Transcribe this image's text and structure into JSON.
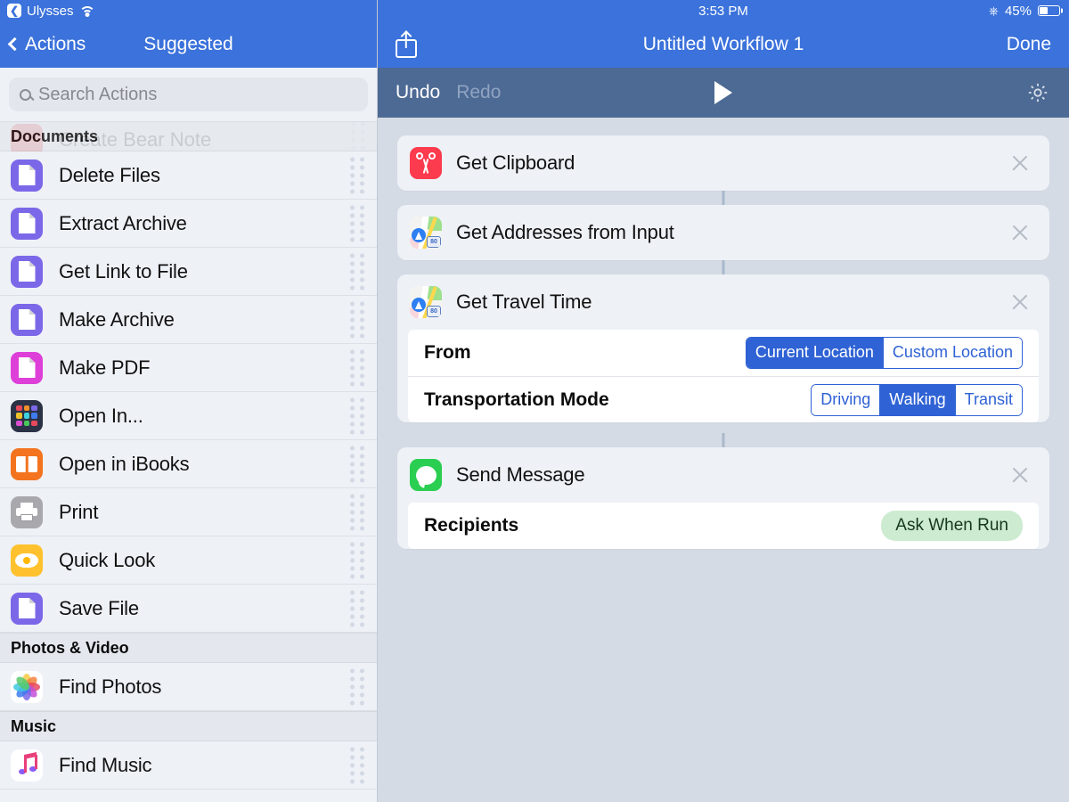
{
  "sidebar": {
    "status": {
      "app_back_label": "Ulysses",
      "wifi_icon": "wifi-icon"
    },
    "navbar": {
      "back_label": "Actions",
      "title": "Suggested"
    },
    "search": {
      "placeholder": "Search Actions",
      "icon": "search-icon"
    },
    "ghost_row": {
      "label": "Create Bear Note"
    },
    "sections": [
      {
        "title": "Documents",
        "items": [
          {
            "label": "Delete Files",
            "icon": "document-icon",
            "bg": "#7B68E8",
            "art": "doc"
          },
          {
            "label": "Extract Archive",
            "icon": "document-icon",
            "bg": "#7B68E8",
            "art": "doc"
          },
          {
            "label": "Get Link to File",
            "icon": "document-icon",
            "bg": "#7B68E8",
            "art": "doc"
          },
          {
            "label": "Make Archive",
            "icon": "document-icon",
            "bg": "#7B68E8",
            "art": "doc"
          },
          {
            "label": "Make PDF",
            "icon": "make-pdf-icon",
            "bg": "#DE3FD8",
            "art": "pdf"
          },
          {
            "label": "Open In...",
            "icon": "open-in-icon",
            "bg": "#2C3246",
            "art": "grid"
          },
          {
            "label": "Open in iBooks",
            "icon": "ibooks-icon",
            "bg": "#F4731E",
            "art": "book"
          },
          {
            "label": "Print",
            "icon": "printer-icon",
            "bg": "#A8A8AD",
            "art": "printer"
          },
          {
            "label": "Quick Look",
            "icon": "quick-look-icon",
            "bg": "#FFC22E",
            "art": "eye"
          },
          {
            "label": "Save File",
            "icon": "document-icon",
            "bg": "#7B68E8",
            "art": "doc"
          }
        ]
      },
      {
        "title": "Photos & Video",
        "items": [
          {
            "label": "Find Photos",
            "icon": "photos-app-icon",
            "bg": "#FFFFFF",
            "art": "photos"
          }
        ]
      },
      {
        "title": "Music",
        "items": [
          {
            "label": "Find Music",
            "icon": "music-app-icon",
            "bg": "#FFFFFF",
            "art": "music"
          }
        ]
      }
    ],
    "grip_icon": "drag-handle-icon"
  },
  "right": {
    "status": {
      "time": "3:53 PM",
      "bluetooth_icon": "bluetooth-icon",
      "battery_percent": "45%",
      "battery_level": 45
    },
    "navbar": {
      "share_icon": "share-icon",
      "title": "Untitled Workflow 1",
      "done_label": "Done"
    },
    "toolbar": {
      "undo_label": "Undo",
      "redo_label": "Redo",
      "play_icon": "play-icon",
      "settings_icon": "gear-icon"
    },
    "cards": [
      {
        "title": "Get Clipboard",
        "icon": "clipboard-scissors-icon",
        "icon_bg": "#FC3B4E",
        "art": "scissors",
        "remove_icon": "close-icon",
        "params": []
      },
      {
        "title": "Get Addresses from Input",
        "icon": "maps-icon",
        "icon_bg": "#FFFFFF",
        "art": "maps",
        "remove_icon": "close-icon",
        "params": []
      },
      {
        "title": "Get Travel Time",
        "icon": "maps-icon",
        "icon_bg": "#FFFFFF",
        "art": "maps",
        "remove_icon": "close-icon",
        "params": [
          {
            "label": "From",
            "type": "segmented",
            "options": [
              "Current Location",
              "Custom Location"
            ],
            "selected": "Current Location"
          },
          {
            "label": "Transportation Mode",
            "type": "segmented",
            "options": [
              "Driving",
              "Walking",
              "Transit"
            ],
            "selected": "Walking"
          }
        ]
      },
      {
        "title": "Send Message",
        "icon": "messages-icon",
        "icon_bg": "#2ACE50",
        "art": "bubble",
        "remove_icon": "close-icon",
        "params": [
          {
            "label": "Recipients",
            "type": "pill",
            "value": "Ask When Run"
          }
        ]
      }
    ]
  },
  "colors": {
    "nav_blue": "#3B72DB",
    "toolbar_blue_gray": "#4D6A94",
    "canvas_bg": "#D4DBE5",
    "card_bg": "#EEF1F6",
    "accent_segment": "#2F62D4",
    "pill_green_bg": "#CDEBD1"
  }
}
